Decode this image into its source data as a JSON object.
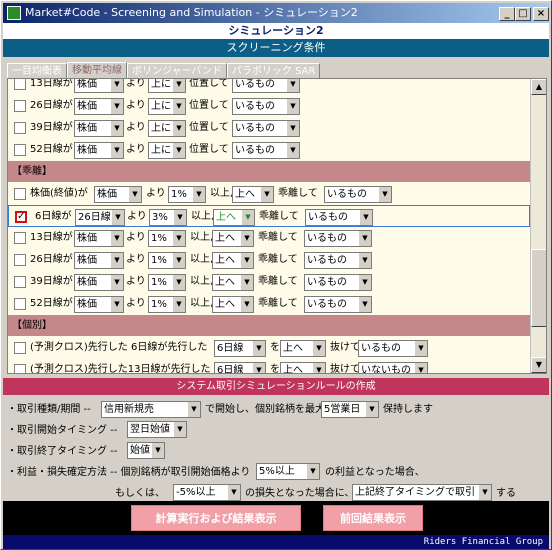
{
  "window": {
    "title": "Market#Code  - Screening and Simulation -    シミュレーション2",
    "min_btn": "_",
    "max_btn": "□",
    "close_btn": "×"
  },
  "header": {
    "sim_title": "シミュレーション2",
    "screening_title": "スクリーニング条件"
  },
  "tabs": [
    {
      "label": "一目均衡表"
    },
    {
      "label": "移動平均線"
    },
    {
      "label": "ボリンジャーバンド"
    },
    {
      "label": "パラボリック SAR"
    }
  ],
  "position_rows": [
    {
      "label": "13日線が",
      "f1": "株価",
      "t1": "より",
      "f2": "上に",
      "t2": "位置して",
      "f3": "いるもの",
      "checked": false
    },
    {
      "label": "26日線が",
      "f1": "株価",
      "t1": "より",
      "f2": "上に",
      "t2": "位置して",
      "f3": "いるもの",
      "checked": false
    },
    {
      "label": "39日線が",
      "f1": "株価",
      "t1": "より",
      "f2": "上に",
      "t2": "位置して",
      "f3": "いるもの",
      "checked": false
    },
    {
      "label": "52日線が",
      "f1": "株価",
      "t1": "より",
      "f2": "上に",
      "t2": "位置して",
      "f3": "いるもの",
      "checked": false
    }
  ],
  "section_divergence": "【乖離】",
  "divergence_rows": [
    {
      "label": "株価(終値)が",
      "f1": "株価",
      "t1": "より",
      "f2": "1%",
      "t2": "以上,",
      "f3": "上へ",
      "t3": "乖離して",
      "f4": "いるもの",
      "checked": false
    },
    {
      "label": "6日線が",
      "f1": "26日線",
      "t1": "より",
      "f2": "3%",
      "t2": "以上,",
      "f3": "上へ",
      "t3": "乖離して",
      "f4": "いるもの",
      "checked": true
    },
    {
      "label": "13日線が",
      "f1": "株価",
      "t1": "より",
      "f2": "1%",
      "t2": "以上,",
      "f3": "上へ",
      "t3": "乖離して",
      "f4": "いるもの",
      "checked": false
    },
    {
      "label": "26日線が",
      "f1": "株価",
      "t1": "より",
      "f2": "1%",
      "t2": "以上,",
      "f3": "上へ",
      "t3": "乖離して",
      "f4": "いるもの",
      "checked": false
    },
    {
      "label": "39日線が",
      "f1": "株価",
      "t1": "より",
      "f2": "1%",
      "t2": "以上,",
      "f3": "上へ",
      "t3": "乖離して",
      "f4": "いるもの",
      "checked": false
    },
    {
      "label": "52日線が",
      "f1": "株価",
      "t1": "より",
      "f2": "1%",
      "t2": "以上,",
      "f3": "上へ",
      "t3": "乖離して",
      "f4": "いるもの",
      "checked": false
    }
  ],
  "section_individual": "【個別】",
  "cross_rows": [
    {
      "label": "(予測クロス)先行した 6日線が先行した",
      "f1": "6日線",
      "t1": "を",
      "f2": "上へ",
      "t2": "抜けて",
      "f3": "いるもの",
      "checked": false
    },
    {
      "label": "(予測クロス)先行した13日線が先行した",
      "f1": "6日線",
      "t1": "を",
      "f2": "上へ",
      "t2": "抜けて",
      "f3": "いないもの",
      "checked": false
    }
  ],
  "simulation": {
    "header": "システム取引シミュレーションルールの作成",
    "trade_type_label": "・取引種類/期間  --",
    "trade_type_value": "信用新規売",
    "trade_type_text1": "で開始し、個別銘柄を最大",
    "hold_value": "5営業日",
    "trade_type_text2": "保持します",
    "start_timing_label": "・取引開始タイミング  --",
    "start_timing_value": "翌日始値",
    "end_timing_label": "・取引終了タイミング  --",
    "end_timing_value": "始値",
    "profit_label": "・利益・損失確定方法  --  個別銘柄が取引開始価格より",
    "profit_value": "5%以上",
    "profit_text": "の利益となった場合、",
    "loss_prefix": "もしくは、",
    "loss_value": "-5%以上",
    "loss_text": "の損失となった場合に、",
    "exit_value": "上記終了タイミングで取引",
    "exit_suffix": "する"
  },
  "buttons": {
    "run": "計算実行および結果表示",
    "previous": "前回結果表示"
  },
  "brand": "Riders Financial Group"
}
